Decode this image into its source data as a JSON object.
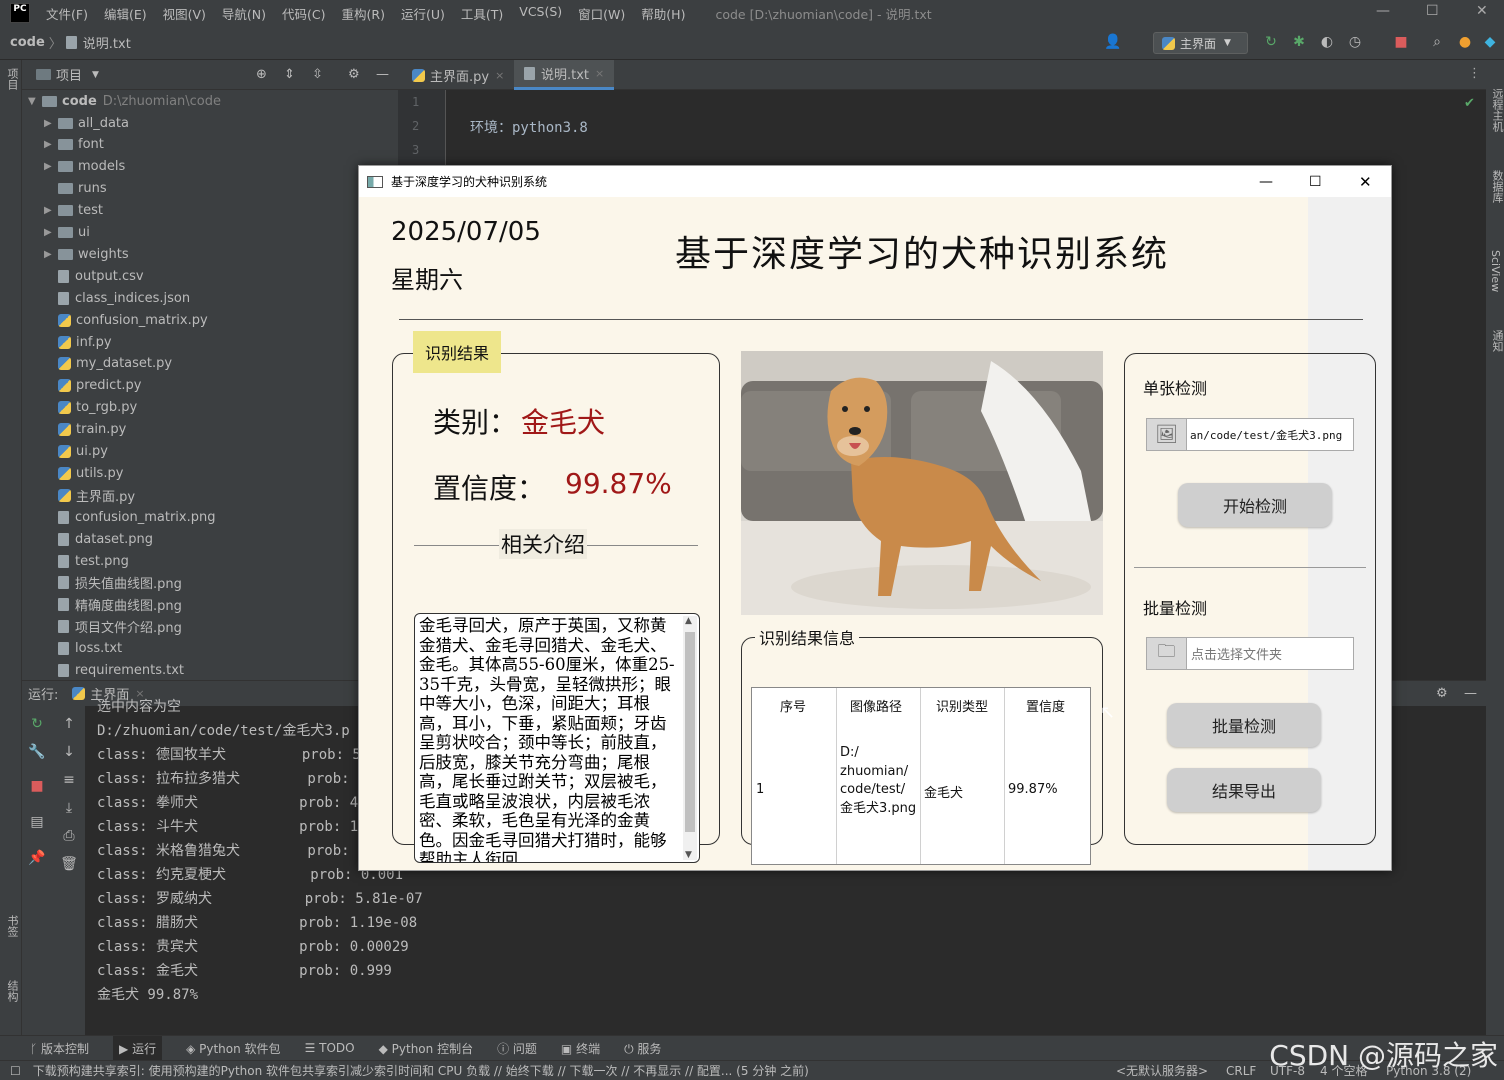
{
  "menubar": {
    "logo": "PC",
    "items": [
      "文件(F)",
      "编辑(E)",
      "视图(V)",
      "导航(N)",
      "代码(C)",
      "重构(R)",
      "运行(U)",
      "工具(T)",
      "VCS(S)",
      "窗口(W)",
      "帮助(H)"
    ],
    "title": "code [D:\\zhuomian\\code] - 说明.txt"
  },
  "navbar": {
    "project": "code",
    "separator": "〉",
    "file": "说明.txt",
    "run_config": "主界面"
  },
  "strips": {
    "left_top": "项目",
    "left_bottom1": "书签",
    "left_bottom2": "结构",
    "right1": "远程主机",
    "right2": "数据库",
    "right3": "SciView",
    "right4": "通知"
  },
  "project_panel": {
    "title": "项目",
    "root": {
      "name": "code",
      "path": "D:\\zhuomian\\code"
    },
    "items": [
      {
        "name": "all_data",
        "type": "folder",
        "expandable": true
      },
      {
        "name": "font",
        "type": "folder",
        "expandable": true
      },
      {
        "name": "models",
        "type": "folder",
        "expandable": true
      },
      {
        "name": "runs",
        "type": "folder",
        "expandable": false
      },
      {
        "name": "test",
        "type": "folder",
        "expandable": true
      },
      {
        "name": "ui",
        "type": "folder",
        "expandable": true
      },
      {
        "name": "weights",
        "type": "folder",
        "expandable": true
      },
      {
        "name": "output.csv",
        "type": "file"
      },
      {
        "name": "class_indices.json",
        "type": "file"
      },
      {
        "name": "confusion_matrix.py",
        "type": "py"
      },
      {
        "name": "inf.py",
        "type": "py"
      },
      {
        "name": "my_dataset.py",
        "type": "py"
      },
      {
        "name": "predict.py",
        "type": "py"
      },
      {
        "name": "to_rgb.py",
        "type": "py"
      },
      {
        "name": "train.py",
        "type": "py"
      },
      {
        "name": "ui.py",
        "type": "py"
      },
      {
        "name": "utils.py",
        "type": "py"
      },
      {
        "name": "主界面.py",
        "type": "py"
      },
      {
        "name": "confusion_matrix.png",
        "type": "file"
      },
      {
        "name": "dataset.png",
        "type": "file"
      },
      {
        "name": "test.png",
        "type": "file"
      },
      {
        "name": "损失值曲线图.png",
        "type": "file"
      },
      {
        "name": "精确度曲线图.png",
        "type": "file"
      },
      {
        "name": "项目文件介绍.png",
        "type": "file"
      },
      {
        "name": "loss.txt",
        "type": "file"
      },
      {
        "name": "requirements.txt",
        "type": "file"
      }
    ]
  },
  "editor": {
    "tabs": [
      {
        "label": "主界面.py",
        "active": false
      },
      {
        "label": "说明.txt",
        "active": true
      }
    ],
    "line_numbers": [
      "1",
      "2",
      "3"
    ],
    "lines": [
      "",
      "环境：python3.8",
      ""
    ]
  },
  "run_panel": {
    "label": "运行:",
    "tab": "主界面",
    "console": [
      "选中内容为空",
      "D:/zhuomian/code/test/金毛犬3.p",
      "class: 德国牧羊犬         prob: 5",
      "class: 拉布拉多猎犬        prob: ",
      "class: 拳师犬            prob: 4.",
      "class: 斗牛犬            prob: 1.",
      "class: 米格鲁猎兔犬        prob: ",
      "class: 约克夏梗犬          prob: 0.001",
      "class: 罗威纳犬           prob: 5.81e-07",
      "class: 腊肠犬            prob: 1.19e-08",
      "class: 贵宾犬            prob: 0.00029",
      "class: 金毛犬            prob: 0.999",
      "金毛犬 99.87%"
    ]
  },
  "tool_tabs": [
    "版本控制",
    "运行",
    "Python 软件包",
    "TODO",
    "Python 控制台",
    "问题",
    "终端",
    "服务"
  ],
  "statusbar": {
    "message": "下载预构建共享索引: 使用预构建的Python 软件包共享索引减少索引时间和 CPU 负载 // 始终下载 // 下载一次 // 不再显示 // 配置... (5 分钟 之前)",
    "server": "<无默认服务器>",
    "line_sep": "CRLF",
    "encoding": "UTF-8",
    "indent": "4 个空格",
    "interpreter": "Python 3.8 (2)"
  },
  "watermark": "CSDN @源码之家",
  "app": {
    "window_title": "基于深度学习的犬种识别系统",
    "date": "2025/07/05",
    "weekday": "星期六",
    "main_title": "基于深度学习的犬种识别系统",
    "result_group": {
      "title": "识别结果",
      "category_label": "类别：",
      "category_value": "金毛犬",
      "confidence_label": "置信度：",
      "confidence_value": "99.87%",
      "intro_title": "相关介绍",
      "intro_text": "金毛寻回犬，原产于英国，又称黄金猎犬、金毛寻回猎犬、金毛犬、金毛。其体高55-60厘米，体重25-35千克，头骨宽，呈轻微拱形；眼中等大小，色深，间距大；耳根高，耳小，下垂，紧贴面颊；牙齿呈剪状咬合；颈中等长；前肢直，后肢宽，膝关节充分弯曲；尾根高，尾长垂过跗关节；双层被毛，毛直或略呈波浪状，内层被毛浓密、柔软，毛色呈有光泽的金黄色。因金毛寻回猎犬打猎时，能够帮助主人衔回"
    },
    "info_group": {
      "title": "识别结果信息",
      "headers": [
        "序号",
        "图像路径",
        "识别类型",
        "置信度"
      ],
      "rows": [
        {
          "index": "1",
          "path": "D:/\nzhuomian/\ncode/test/\n金毛犬3.png",
          "type": "金毛犬",
          "confidence": "99.87%"
        }
      ]
    },
    "single": {
      "title": "单张检测",
      "path_value": "an/code/test/金毛犬3.png",
      "start_button": "开始检测"
    },
    "batch": {
      "title": "批量检测",
      "folder_placeholder": "点击选择文件夹",
      "batch_button": "批量检测",
      "export_button": "结果导出"
    }
  }
}
